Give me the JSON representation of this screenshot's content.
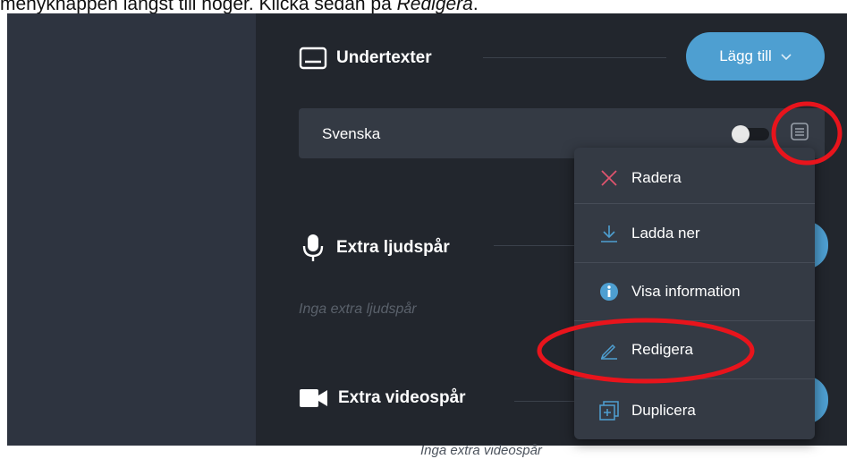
{
  "instruction": {
    "prefix": "menyknappen längst till höger. Klicka sedan på ",
    "emphasis": "Redigera",
    "suffix": "."
  },
  "subtitles": {
    "title": "Undertexter",
    "icon": "subtitles-icon",
    "add_label": "Lägg till",
    "track_name": "Svenska",
    "menu_icon": "menu-list-icon"
  },
  "audio": {
    "title": "Extra ljudspår",
    "icon": "microphone-icon",
    "empty_text": "Inga extra ljudspår"
  },
  "video": {
    "title": "Extra videospår",
    "icon": "video-camera-icon",
    "empty_text": "Inga extra videospår"
  },
  "menu": {
    "items": [
      {
        "label": "Radera",
        "icon": "close-icon"
      },
      {
        "label": "Ladda ner",
        "icon": "download-icon"
      },
      {
        "label": "Visa information",
        "icon": "info-icon"
      },
      {
        "label": "Redigera",
        "icon": "pencil-icon"
      },
      {
        "label": "Duplicera",
        "icon": "duplicate-icon"
      }
    ]
  },
  "colors": {
    "accent": "#4e9fd1",
    "panel": "#22262d",
    "sidebar": "#2e3440",
    "highlight": "#e8141c"
  }
}
